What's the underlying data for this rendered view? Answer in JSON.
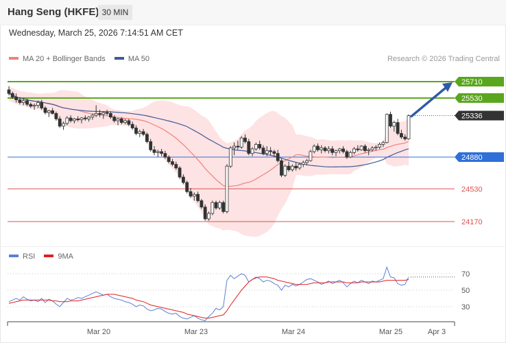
{
  "header": {
    "title": "Hang Seng (HKFE)",
    "timeframe": "30 MIN"
  },
  "datetime": "Wednesday, March 25, 2026 7:14:51 AM CET",
  "legend": {
    "ma20": "MA 20 + Bollinger Bands",
    "ma50": "MA 50",
    "ma20_color": "#f08080",
    "ma50_color": "#3d5a99"
  },
  "credit": "Research © 2026 Trading Central",
  "rsi_legend": {
    "rsi": "RSI",
    "ma9": "9MA",
    "rsi_color": "#5b7fd6",
    "ma9_color": "#e02020"
  },
  "chart_data": [
    {
      "type": "candlestick",
      "title": "Hang Seng (HKFE)",
      "interval": "30 MIN",
      "x_ticks": [
        "Mar 20",
        "Mar 23",
        "Mar 24",
        "Mar 25",
        "Apr 3"
      ],
      "last_price": 25336,
      "ylim": [
        24000,
        25900
      ],
      "levels": [
        {
          "value": 25710,
          "label": "25710",
          "kind": "resistance",
          "color": "#5aa61e"
        },
        {
          "value": 25530,
          "label": "25530",
          "kind": "resistance",
          "color": "#5aa61e"
        },
        {
          "value": 25336,
          "label": "25336",
          "kind": "last",
          "color": "#333333"
        },
        {
          "value": 24880,
          "label": "24880",
          "kind": "pivot",
          "color": "#2f6fd8"
        },
        {
          "value": 24530,
          "label": "24530",
          "kind": "support",
          "color": "#e05050"
        },
        {
          "value": 24170,
          "label": "24170",
          "kind": "support",
          "color": "#e05050"
        }
      ],
      "candles": [
        [
          25620,
          25660,
          25560,
          25580
        ],
        [
          25580,
          25600,
          25520,
          25540
        ],
        [
          25540,
          25580,
          25480,
          25510
        ],
        [
          25510,
          25540,
          25460,
          25480
        ],
        [
          25480,
          25530,
          25450,
          25500
        ],
        [
          25500,
          25520,
          25440,
          25460
        ],
        [
          25460,
          25480,
          25420,
          25440
        ],
        [
          25440,
          25470,
          25400,
          25450
        ],
        [
          25450,
          25500,
          25420,
          25480
        ],
        [
          25480,
          25510,
          25400,
          25420
        ],
        [
          25420,
          25440,
          25350,
          25370
        ],
        [
          25370,
          25400,
          25320,
          25390
        ],
        [
          25390,
          25420,
          25350,
          25360
        ],
        [
          25360,
          25380,
          25280,
          25300
        ],
        [
          25300,
          25330,
          25200,
          25220
        ],
        [
          25220,
          25270,
          25180,
          25250
        ],
        [
          25250,
          25330,
          25230,
          25310
        ],
        [
          25310,
          25340,
          25260,
          25280
        ],
        [
          25280,
          25310,
          25250,
          25300
        ],
        [
          25300,
          25330,
          25270,
          25290
        ],
        [
          25290,
          25320,
          25250,
          25310
        ],
        [
          25310,
          25340,
          25280,
          25300
        ],
        [
          25300,
          25330,
          25270,
          25320
        ],
        [
          25320,
          25360,
          25290,
          25340
        ],
        [
          25340,
          25450,
          25320,
          25360
        ],
        [
          25360,
          25400,
          25320,
          25350
        ],
        [
          25350,
          25380,
          25300,
          25370
        ],
        [
          25370,
          25400,
          25340,
          25360
        ],
        [
          25360,
          25380,
          25300,
          25320
        ],
        [
          25320,
          25340,
          25260,
          25280
        ],
        [
          25280,
          25310,
          25230,
          25300
        ],
        [
          25300,
          25320,
          25240,
          25260
        ],
        [
          25260,
          25300,
          25240,
          25280
        ],
        [
          25280,
          25300,
          25220,
          25240
        ],
        [
          25240,
          25270,
          25180,
          25200
        ],
        [
          25200,
          25230,
          25120,
          25140
        ],
        [
          25140,
          25180,
          25100,
          25160
        ],
        [
          25160,
          25190,
          25110,
          25130
        ],
        [
          25130,
          25150,
          25030,
          25050
        ],
        [
          25050,
          25080,
          24940,
          24960
        ],
        [
          24960,
          25000,
          24900,
          24930
        ],
        [
          24930,
          24960,
          24880,
          24940
        ],
        [
          24940,
          24970,
          24890,
          24920
        ],
        [
          24920,
          24950,
          24860,
          24880
        ],
        [
          24880,
          24900,
          24810,
          24830
        ],
        [
          24830,
          24860,
          24780,
          24800
        ],
        [
          24800,
          24830,
          24740,
          24760
        ],
        [
          24760,
          24780,
          24640,
          24660
        ],
        [
          24660,
          24690,
          24580,
          24600
        ],
        [
          24600,
          24620,
          24480,
          24500
        ],
        [
          24500,
          24540,
          24430,
          24450
        ],
        [
          24450,
          24490,
          24400,
          24470
        ],
        [
          24470,
          24500,
          24380,
          24400
        ],
        [
          24400,
          24420,
          24310,
          24330
        ],
        [
          24330,
          24360,
          24180,
          24200
        ],
        [
          24200,
          24280,
          24180,
          24260
        ],
        [
          24260,
          24400,
          24240,
          24380
        ],
        [
          24380,
          24400,
          24300,
          24320
        ],
        [
          24320,
          24400,
          24300,
          24380
        ],
        [
          24380,
          24400,
          24260,
          24280
        ],
        [
          24280,
          24800,
          24260,
          24780
        ],
        [
          24780,
          25000,
          24760,
          24980
        ],
        [
          24980,
          25040,
          24900,
          25000
        ],
        [
          25000,
          25060,
          24960,
          24990
        ],
        [
          24990,
          25110,
          24970,
          25090
        ],
        [
          25090,
          25130,
          25030,
          25050
        ],
        [
          25050,
          25080,
          24900,
          24920
        ],
        [
          24920,
          24990,
          24890,
          24970
        ],
        [
          24970,
          25040,
          24950,
          25020
        ],
        [
          25020,
          25060,
          24960,
          24980
        ],
        [
          24980,
          25010,
          24900,
          24920
        ],
        [
          24920,
          25000,
          24890,
          24950
        ],
        [
          24950,
          24990,
          24900,
          24940
        ],
        [
          24940,
          24960,
          24880,
          24920
        ],
        [
          24920,
          24960,
          24820,
          24840
        ],
        [
          24840,
          24860,
          24660,
          24680
        ],
        [
          24680,
          24800,
          24660,
          24780
        ],
        [
          24780,
          24830,
          24720,
          24740
        ],
        [
          24740,
          24800,
          24720,
          24780
        ],
        [
          24780,
          24820,
          24730,
          24760
        ],
        [
          24760,
          24820,
          24740,
          24800
        ],
        [
          24800,
          24840,
          24770,
          24820
        ],
        [
          24820,
          24860,
          24790,
          24840
        ],
        [
          24840,
          24960,
          24830,
          24940
        ],
        [
          24940,
          25020,
          24920,
          25000
        ],
        [
          25000,
          25030,
          24940,
          24960
        ],
        [
          24960,
          25010,
          24920,
          24980
        ],
        [
          24980,
          25000,
          24930,
          24950
        ],
        [
          24950,
          25000,
          24920,
          24970
        ],
        [
          24970,
          25000,
          24900,
          24930
        ],
        [
          24930,
          24960,
          24890,
          24950
        ],
        [
          24950,
          24980,
          24920,
          24970
        ],
        [
          24970,
          25000,
          24920,
          24940
        ],
        [
          24940,
          24960,
          24860,
          24880
        ],
        [
          24880,
          24950,
          24870,
          24930
        ],
        [
          24930,
          24990,
          24910,
          24970
        ],
        [
          24970,
          25010,
          24940,
          24960
        ],
        [
          24960,
          25010,
          24950,
          25000
        ],
        [
          25000,
          25020,
          24930,
          24950
        ],
        [
          24950,
          24980,
          24900,
          24960
        ],
        [
          24960,
          25000,
          24940,
          24980
        ],
        [
          24980,
          25010,
          24950,
          24990
        ],
        [
          24990,
          25040,
          24970,
          25020
        ],
        [
          25020,
          25060,
          24990,
          25040
        ],
        [
          25040,
          25360,
          25030,
          25350
        ],
        [
          25350,
          25380,
          25200,
          25220
        ],
        [
          25220,
          25280,
          25160,
          25260
        ],
        [
          25260,
          25300,
          25120,
          25140
        ],
        [
          25140,
          25180,
          25080,
          25100
        ],
        [
          25100,
          25130,
          25060,
          25080
        ],
        [
          25080,
          25350,
          25070,
          25336
        ]
      ]
    },
    {
      "type": "line",
      "title": "RSI",
      "x_ticks": [
        "Mar 20",
        "Mar 23",
        "Mar 24",
        "Mar 25",
        "Apr 3"
      ],
      "y_ticks": [
        70,
        50,
        30
      ],
      "ylim": [
        10,
        80
      ],
      "series": [
        {
          "name": "RSI",
          "color": "#5b7fd6",
          "values": [
            36,
            38,
            40,
            38,
            42,
            39,
            37,
            38,
            36,
            40,
            35,
            39,
            37,
            33,
            30,
            35,
            40,
            38,
            39,
            41,
            40,
            42,
            44,
            46,
            48,
            46,
            44,
            45,
            42,
            40,
            39,
            38,
            36,
            35,
            33,
            30,
            32,
            31,
            27,
            25,
            26,
            28,
            27,
            24,
            22,
            21,
            22,
            18,
            16,
            15,
            17,
            19,
            16,
            14,
            13,
            18,
            22,
            28,
            26,
            30,
            62,
            68,
            64,
            67,
            70,
            68,
            60,
            63,
            66,
            64,
            60,
            62,
            61,
            58,
            56,
            50,
            56,
            54,
            57,
            55,
            57,
            60,
            63,
            64,
            62,
            60,
            57,
            59,
            61,
            58,
            60,
            62,
            59,
            54,
            58,
            61,
            59,
            62,
            60,
            58,
            61,
            60,
            62,
            64,
            78,
            66,
            65,
            58,
            56,
            57,
            66
          ]
        },
        {
          "name": "9MA",
          "color": "#e02020",
          "values": [
            34,
            35,
            36,
            37,
            38,
            38,
            38,
            38,
            38,
            38,
            38,
            38,
            37,
            37,
            36,
            36,
            36,
            37,
            37,
            37,
            38,
            39,
            40,
            41,
            42,
            43,
            44,
            45,
            45,
            45,
            44,
            43,
            42,
            41,
            40,
            38,
            37,
            36,
            34,
            32,
            31,
            30,
            29,
            28,
            27,
            26,
            25,
            24,
            23,
            21,
            20,
            19,
            18,
            17,
            16,
            16,
            17,
            18,
            19,
            20,
            25,
            32,
            38,
            44,
            50,
            55,
            60,
            63,
            65,
            66,
            66,
            66,
            65,
            64,
            62,
            61,
            60,
            59,
            58,
            57,
            57,
            57,
            57,
            58,
            59,
            59,
            59,
            59,
            60,
            60,
            60,
            60,
            60,
            59,
            59,
            59,
            59,
            60,
            60,
            60,
            60,
            60,
            60,
            61,
            62,
            62,
            62,
            62,
            62,
            62,
            63
          ]
        }
      ]
    }
  ]
}
